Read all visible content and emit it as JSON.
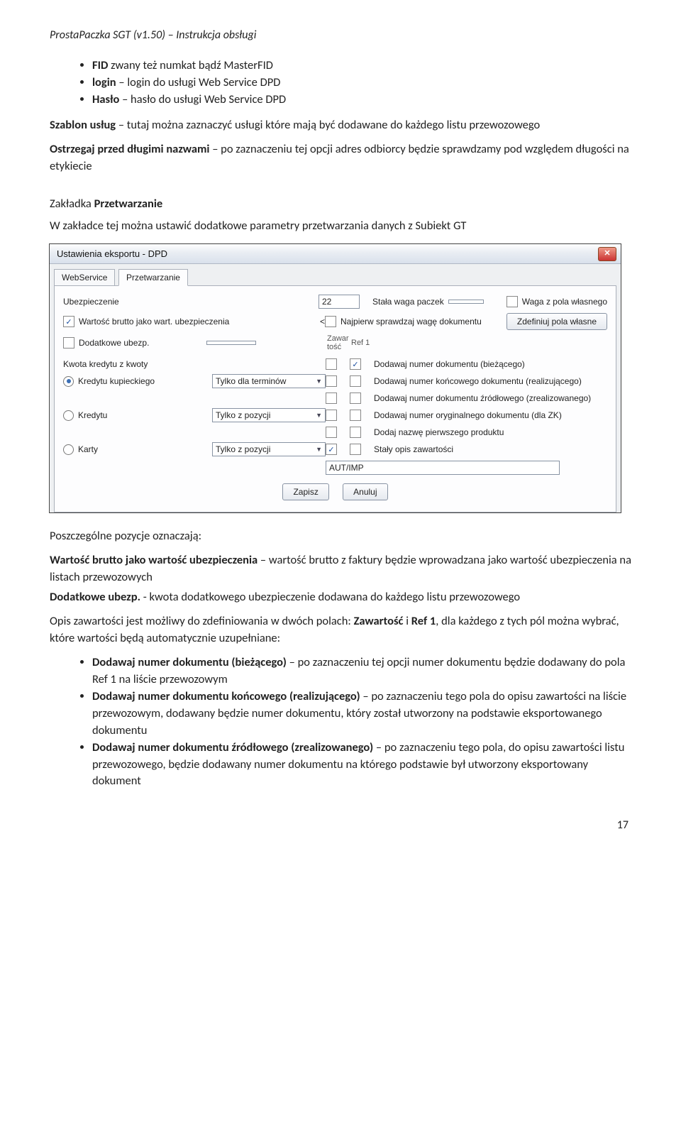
{
  "doc": {
    "header": "ProstaPaczka SGT (v1.50) – Instrukcja obsługi",
    "fid_line_prefix": "FID",
    "fid_line_rest": " zwany też numkat bądź MasterFID",
    "login_line_prefix": "login",
    "login_line_rest": " – login do usługi Web Service DPD",
    "haslo_line_prefix": "Hasło",
    "haslo_line_rest": " – hasło do usługi Web Service DPD",
    "szablon_prefix": "Szablon usług",
    "szablon_rest": " – tutaj można zaznaczyć usługi które mają być dodawane do każdego listu przewozowego",
    "ostrzegaj_prefix": "Ostrzegaj przed długimi nazwami",
    "ostrzegaj_rest": " – po zaznaczeniu tej opcji adres odbiorcy będzie sprawdzamy pod względem długości na etykiecie",
    "zakladka_prefix": "Zakładka ",
    "zakladka_bold": "Przetwarzanie",
    "zakladka_para": "W zakładce tej można ustawić dodatkowe parametry przetwarzania danych z Subiekt GT",
    "pozycje": "Poszczególne pozycje oznaczają:",
    "wartosc_prefix": "Wartość brutto jako wartość ubezpieczenia",
    "wartosc_rest": " – wartość brutto z faktury będzie wprowadzana jako wartość ubezpieczenia na listach przewozowych",
    "dodatkowe_prefix": "Dodatkowe ubezp.",
    "dodatkowe_rest": " - kwota dodatkowego ubezpieczenie dodawana do każdego listu przewozowego",
    "opis_part1": "Opis zawartości jest możliwy do zdefiniowania w dwóch polach: ",
    "opis_bold1": "Zawartość",
    "opis_mid": " i ",
    "opis_bold2": "Ref 1",
    "opis_part2": ", dla każdego z tych pól można wybrać, które wartości będą automatycznie uzupełniane:",
    "li1_b": "Dodawaj numer dokumentu (bieżącego)",
    "li1_r": " – po zaznaczeniu tej opcji numer dokumentu będzie dodawany do pola Ref 1 na liście przewozowym",
    "li2_b": "Dodawaj numer dokumentu końcowego (realizującego)",
    "li2_r": " – po zaznaczeniu tego pola do opisu zawartości na liście przewozowym, dodawany będzie numer dokumentu, który został utworzony na podstawie eksportowanego dokumentu",
    "li3_b": "Dodawaj numer dokumentu źródłowego (zrealizowanego)",
    "li3_r": " – po zaznaczeniu tego pola, do opisu zawartości listu przewozowego, będzie dodawany numer dokumentu na którego podstawie był utworzony eksportowany dokument",
    "page_number": "17"
  },
  "dialog": {
    "title": "Ustawienia eksportu - DPD",
    "tab_webservice": "WebService",
    "tab_przetwarzanie": "Przetwarzanie",
    "lbl_ubezpieczenie": "Ubezpieczenie",
    "val_ubezpieczenie": "22",
    "lbl_stala_waga": "Stała waga paczek",
    "cb_waga_z_pola": "Waga z pola własnego",
    "cb_wartosc_brutto": "Wartość brutto jako wart. ubezpieczenia",
    "cb_najpierw_spr": "Najpierw sprawdzaj wagę dokumentu",
    "btn_zdefiniuj": "Zdefiniuj pola własne",
    "cb_dodatkowe": "Dodatkowe ubezp.",
    "hdr_zawartosc": "Zawar tość",
    "hdr_ref1": "Ref 1",
    "lbl_kwota_kredytu": "Kwota kredytu z kwoty",
    "combo_tylko_terminow": "Tylko dla terminów",
    "cb_dod_biez": "Dodawaj numer dokumentu (bieżącego)",
    "radio_kredytu_kup": "Kredytu kupieckiego",
    "cb_dod_konc": "Dodawaj numer końcowego dokumentu (realizującego)",
    "cb_dod_zrod": "Dodawaj numer dokumentu źródłowego (zrealizowanego)",
    "radio_kredytu": "Kredytu",
    "combo_tylko_poz1": "Tylko z pozycji",
    "cb_dod_oryg": "Dodawaj numer oryginalnego dokumentu (dla ZK)",
    "cb_dod_nazwe": "Dodaj nazwę pierwszego produktu",
    "radio_karty": "Karty",
    "combo_tylko_poz2": "Tylko z pozycji",
    "cb_staly_opis": "Stały opis zawartości",
    "input_autimp": "AUT/IMP",
    "btn_zapisz": "Zapisz",
    "btn_anuluj": "Anuluj",
    "close_x": "✕"
  }
}
